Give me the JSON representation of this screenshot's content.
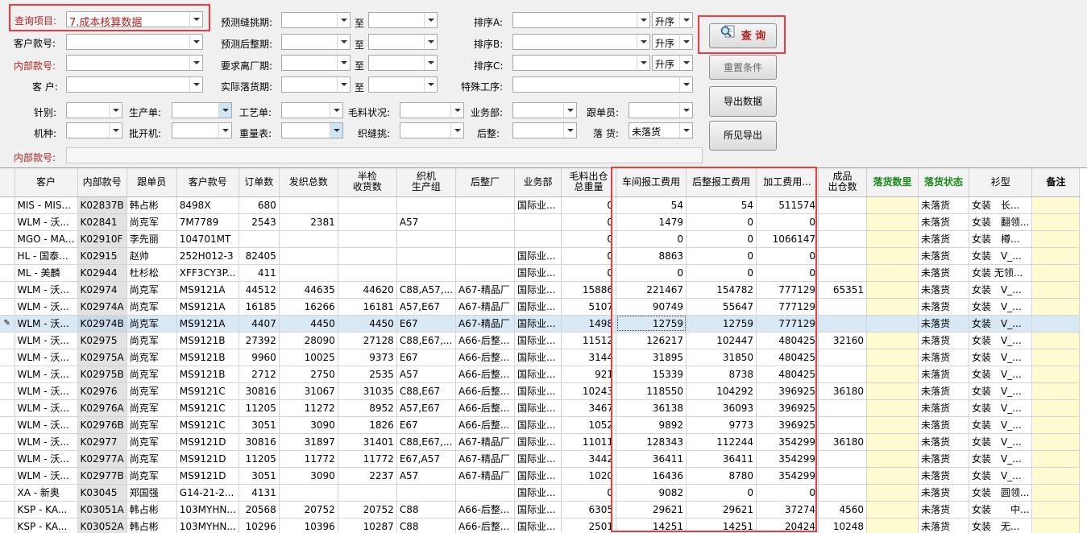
{
  "filter": {
    "query_item_label": "查询项目:",
    "query_item_value": "7.成本核算数据",
    "cust_style_label": "客户款号:",
    "internal_no_label": "内部款号:",
    "customer_label": "客 户:",
    "pre_seam_label": "预测缝挑期:",
    "pre_finish_label": "预测后整期:",
    "req_leave_label": "要求离厂期:",
    "actual_ship_label": "实际落货期:",
    "to": "至",
    "sortA_label": "排序A:",
    "sortB_label": "排序B:",
    "sortC_label": "排序C:",
    "asc": "升序",
    "special_label": "特殊工序:",
    "needle_label": "针别:",
    "prod_order_label": "生产单:",
    "craft_order_label": "工艺单:",
    "wool_label": "毛料状况:",
    "business_label": "业务部:",
    "follower_label": "跟单员:",
    "machine_label": "机种:",
    "cutter_label": "批开机:",
    "weight_label": "重量表:",
    "seam_label": "织缝挑:",
    "finish_label": "后整:",
    "ship_label": "落 货:",
    "ship_value": "未落货",
    "internal_no2_label": "内部款号:"
  },
  "buttons": {
    "query": "查 询",
    "reset": "重置条件",
    "export": "导出数据",
    "export_visible": "所见导出"
  },
  "table": {
    "headers": [
      "客户",
      "内部款号",
      "跟单员",
      "客户款号",
      "订单数",
      "发织总数",
      "半检\n收货数",
      "织机\n生产组",
      "后整厂",
      "业务部",
      "毛料出仓\n总重量",
      "车间报工费用",
      "后整报工费用",
      "加工费用...",
      "成品\n出仓数",
      "落货数里",
      "落货状态",
      "衫型",
      "备注"
    ],
    "rows": [
      [
        "MIS - MIS...",
        "K02837B",
        "韩占彬",
        "8498X",
        "680",
        "",
        "",
        "",
        "",
        "国际业...",
        "0",
        "54",
        "54",
        "511574",
        "",
        "",
        "未落货",
        "女装　长...",
        ""
      ],
      [
        "WLM - 沃...",
        "K02841",
        "尚克军",
        "7M7789",
        "2543",
        "2381",
        "",
        "A57",
        "",
        "",
        "0",
        "1479",
        "0",
        "0",
        "",
        "",
        "未落货",
        "女装　翻领...",
        ""
      ],
      [
        "MGO - MA...",
        "K02910F",
        "李先丽",
        "104701MT",
        "",
        "",
        "",
        "",
        "",
        "",
        "0",
        "0",
        "0",
        "1066147",
        "",
        "",
        "未落货",
        "女装　樽...",
        ""
      ],
      [
        "HL - 国泰...",
        "K02915",
        "赵帅",
        "252H012-3",
        "82405",
        "",
        "",
        "",
        "",
        "国际业...",
        "0",
        "8863",
        "0",
        "0",
        "",
        "",
        "未落货",
        "女装　V_...",
        ""
      ],
      [
        "ML - 美麟",
        "K02944",
        "杜杉松",
        "XFF3CY3P...",
        "411",
        "",
        "",
        "",
        "",
        "国际业...",
        "0",
        "0",
        "0",
        "0",
        "",
        "",
        "未落货",
        "女装 无领...",
        ""
      ],
      [
        "WLM - 沃...",
        "K02974",
        "尚克军",
        "MS9121A",
        "44512",
        "44635",
        "44620",
        "C88,A57,...",
        "A67-精品厂",
        "国际业...",
        "15886",
        "221467",
        "154782",
        "777129",
        "65351",
        "",
        "未落货",
        "女装　V_...",
        ""
      ],
      [
        "WLM - 沃...",
        "K02974A",
        "尚克军",
        "MS9121A",
        "16185",
        "16266",
        "16181",
        "A57,E67",
        "A67-精品厂",
        "国际业...",
        "5107",
        "90749",
        "55647",
        "777129",
        "",
        "",
        "未落货",
        "女装　V_...",
        ""
      ],
      [
        "WLM - 沃...",
        "K02974B",
        "尚克军",
        "MS9121A",
        "4407",
        "4450",
        "4450",
        "E67",
        "A67-精品厂",
        "国际业...",
        "1498",
        "12759",
        "12759",
        "777129",
        "",
        "",
        "未落货",
        "女装　V_...",
        ""
      ],
      [
        "WLM - 沃...",
        "K02975",
        "尚克军",
        "MS9121B",
        "27392",
        "28090",
        "27128",
        "C88,E67,...",
        "A66-后整...",
        "国际业...",
        "11512",
        "126217",
        "102447",
        "480425",
        "32160",
        "",
        "未落货",
        "女装　V_...",
        ""
      ],
      [
        "WLM - 沃...",
        "K02975A",
        "尚克军",
        "MS9121B",
        "9960",
        "10025",
        "9373",
        "E67",
        "A66-后整...",
        "国际业...",
        "3144",
        "31895",
        "31850",
        "480425",
        "",
        "",
        "未落货",
        "女装　V_...",
        ""
      ],
      [
        "WLM - 沃...",
        "K02975B",
        "尚克军",
        "MS9121B",
        "2712",
        "2750",
        "2535",
        "A57",
        "A66-后整...",
        "国际业...",
        "921",
        "15339",
        "8738",
        "480425",
        "",
        "",
        "未落货",
        "女装　V_...",
        ""
      ],
      [
        "WLM - 沃...",
        "K02976",
        "尚克军",
        "MS9121C",
        "30816",
        "31067",
        "31035",
        "C88,E67",
        "A66-后整...",
        "国际业...",
        "10243",
        "118550",
        "104292",
        "396925",
        "36180",
        "",
        "未落货",
        "女装　V_...",
        ""
      ],
      [
        "WLM - 沃...",
        "K02976A",
        "尚克军",
        "MS9121C",
        "11205",
        "11272",
        "8952",
        "A57,E67",
        "A66-后整...",
        "国际业...",
        "3467",
        "36138",
        "36093",
        "396925",
        "",
        "",
        "未落货",
        "女装　V_...",
        ""
      ],
      [
        "WLM - 沃...",
        "K02976B",
        "尚克军",
        "MS9121C",
        "3051",
        "3090",
        "1826",
        "E67",
        "A66-后整...",
        "国际业...",
        "1052",
        "9892",
        "9773",
        "396925",
        "",
        "",
        "未落货",
        "女装　V_...",
        ""
      ],
      [
        "WLM - 沃...",
        "K02977",
        "尚克军",
        "MS9121D",
        "30816",
        "31897",
        "31401",
        "C88,E67,...",
        "A67-精品厂",
        "国际业...",
        "11011",
        "128343",
        "112244",
        "354299",
        "36180",
        "",
        "未落货",
        "女装　V_...",
        ""
      ],
      [
        "WLM - 沃...",
        "K02977A",
        "尚克军",
        "MS9121D",
        "11205",
        "11772",
        "11772",
        "E67,A57",
        "A67-精品厂",
        "国际业...",
        "3442",
        "36411",
        "36411",
        "354299",
        "",
        "",
        "未落货",
        "女装　V_...",
        ""
      ],
      [
        "WLM - 沃...",
        "K02977B",
        "尚克军",
        "MS9121D",
        "3051",
        "3090",
        "2237",
        "A57",
        "A67-精品厂",
        "国际业...",
        "1020",
        "16436",
        "8780",
        "354299",
        "",
        "",
        "未落货",
        "女装　V_...",
        ""
      ],
      [
        "XA - 新奥",
        "K03045",
        "郑国强",
        "G14-21-2...",
        "4131",
        "",
        "",
        "",
        "",
        "国际业...",
        "0",
        "9082",
        "0",
        "0",
        "",
        "",
        "未落货",
        "女装　圆领...",
        ""
      ],
      [
        "KSP - KA...",
        "K03051A",
        "韩占彬",
        "103MYHN...",
        "20568",
        "20752",
        "20752",
        "C88",
        "A66-后整...",
        "国际业...",
        "6305",
        "29621",
        "29621",
        "37274",
        "4560",
        "",
        "未落货",
        "女装　　中...",
        ""
      ],
      [
        "KSP - KA...",
        "K03052A",
        "韩占彬",
        "103MYHN...",
        "10296",
        "10396",
        "10287",
        "C88",
        "A66-后整...",
        "国际业...",
        "2501",
        "14251",
        "14251",
        "20424",
        "10248",
        "",
        "未落货",
        "女装　无...",
        ""
      ]
    ]
  }
}
